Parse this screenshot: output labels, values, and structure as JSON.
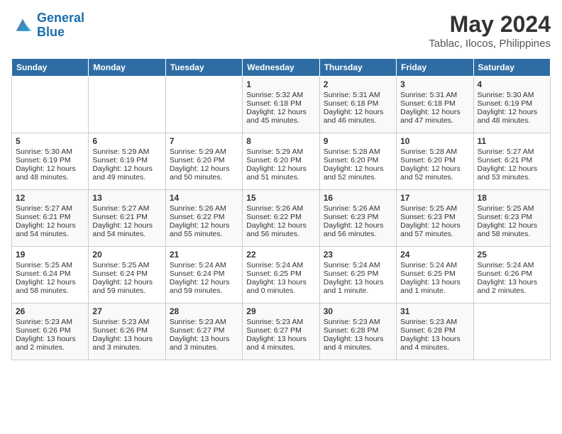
{
  "header": {
    "logo_line1": "General",
    "logo_line2": "Blue",
    "month": "May 2024",
    "location": "Tablac, Ilocos, Philippines"
  },
  "days_of_week": [
    "Sunday",
    "Monday",
    "Tuesday",
    "Wednesday",
    "Thursday",
    "Friday",
    "Saturday"
  ],
  "weeks": [
    [
      {
        "day": "",
        "data": ""
      },
      {
        "day": "",
        "data": ""
      },
      {
        "day": "",
        "data": ""
      },
      {
        "day": "1",
        "data": "Sunrise: 5:32 AM\nSunset: 6:18 PM\nDaylight: 12 hours and 45 minutes."
      },
      {
        "day": "2",
        "data": "Sunrise: 5:31 AM\nSunset: 6:18 PM\nDaylight: 12 hours and 46 minutes."
      },
      {
        "day": "3",
        "data": "Sunrise: 5:31 AM\nSunset: 6:18 PM\nDaylight: 12 hours and 47 minutes."
      },
      {
        "day": "4",
        "data": "Sunrise: 5:30 AM\nSunset: 6:19 PM\nDaylight: 12 hours and 48 minutes."
      }
    ],
    [
      {
        "day": "5",
        "data": "Sunrise: 5:30 AM\nSunset: 6:19 PM\nDaylight: 12 hours and 48 minutes."
      },
      {
        "day": "6",
        "data": "Sunrise: 5:29 AM\nSunset: 6:19 PM\nDaylight: 12 hours and 49 minutes."
      },
      {
        "day": "7",
        "data": "Sunrise: 5:29 AM\nSunset: 6:20 PM\nDaylight: 12 hours and 50 minutes."
      },
      {
        "day": "8",
        "data": "Sunrise: 5:29 AM\nSunset: 6:20 PM\nDaylight: 12 hours and 51 minutes."
      },
      {
        "day": "9",
        "data": "Sunrise: 5:28 AM\nSunset: 6:20 PM\nDaylight: 12 hours and 52 minutes."
      },
      {
        "day": "10",
        "data": "Sunrise: 5:28 AM\nSunset: 6:20 PM\nDaylight: 12 hours and 52 minutes."
      },
      {
        "day": "11",
        "data": "Sunrise: 5:27 AM\nSunset: 6:21 PM\nDaylight: 12 hours and 53 minutes."
      }
    ],
    [
      {
        "day": "12",
        "data": "Sunrise: 5:27 AM\nSunset: 6:21 PM\nDaylight: 12 hours and 54 minutes."
      },
      {
        "day": "13",
        "data": "Sunrise: 5:27 AM\nSunset: 6:21 PM\nDaylight: 12 hours and 54 minutes."
      },
      {
        "day": "14",
        "data": "Sunrise: 5:26 AM\nSunset: 6:22 PM\nDaylight: 12 hours and 55 minutes."
      },
      {
        "day": "15",
        "data": "Sunrise: 5:26 AM\nSunset: 6:22 PM\nDaylight: 12 hours and 56 minutes."
      },
      {
        "day": "16",
        "data": "Sunrise: 5:26 AM\nSunset: 6:23 PM\nDaylight: 12 hours and 56 minutes."
      },
      {
        "day": "17",
        "data": "Sunrise: 5:25 AM\nSunset: 6:23 PM\nDaylight: 12 hours and 57 minutes."
      },
      {
        "day": "18",
        "data": "Sunrise: 5:25 AM\nSunset: 6:23 PM\nDaylight: 12 hours and 58 minutes."
      }
    ],
    [
      {
        "day": "19",
        "data": "Sunrise: 5:25 AM\nSunset: 6:24 PM\nDaylight: 12 hours and 58 minutes."
      },
      {
        "day": "20",
        "data": "Sunrise: 5:25 AM\nSunset: 6:24 PM\nDaylight: 12 hours and 59 minutes."
      },
      {
        "day": "21",
        "data": "Sunrise: 5:24 AM\nSunset: 6:24 PM\nDaylight: 12 hours and 59 minutes."
      },
      {
        "day": "22",
        "data": "Sunrise: 5:24 AM\nSunset: 6:25 PM\nDaylight: 13 hours and 0 minutes."
      },
      {
        "day": "23",
        "data": "Sunrise: 5:24 AM\nSunset: 6:25 PM\nDaylight: 13 hours and 1 minute."
      },
      {
        "day": "24",
        "data": "Sunrise: 5:24 AM\nSunset: 6:25 PM\nDaylight: 13 hours and 1 minute."
      },
      {
        "day": "25",
        "data": "Sunrise: 5:24 AM\nSunset: 6:26 PM\nDaylight: 13 hours and 2 minutes."
      }
    ],
    [
      {
        "day": "26",
        "data": "Sunrise: 5:23 AM\nSunset: 6:26 PM\nDaylight: 13 hours and 2 minutes."
      },
      {
        "day": "27",
        "data": "Sunrise: 5:23 AM\nSunset: 6:26 PM\nDaylight: 13 hours and 3 minutes."
      },
      {
        "day": "28",
        "data": "Sunrise: 5:23 AM\nSunset: 6:27 PM\nDaylight: 13 hours and 3 minutes."
      },
      {
        "day": "29",
        "data": "Sunrise: 5:23 AM\nSunset: 6:27 PM\nDaylight: 13 hours and 4 minutes."
      },
      {
        "day": "30",
        "data": "Sunrise: 5:23 AM\nSunset: 6:28 PM\nDaylight: 13 hours and 4 minutes."
      },
      {
        "day": "31",
        "data": "Sunrise: 5:23 AM\nSunset: 6:28 PM\nDaylight: 13 hours and 4 minutes."
      },
      {
        "day": "",
        "data": ""
      }
    ]
  ]
}
